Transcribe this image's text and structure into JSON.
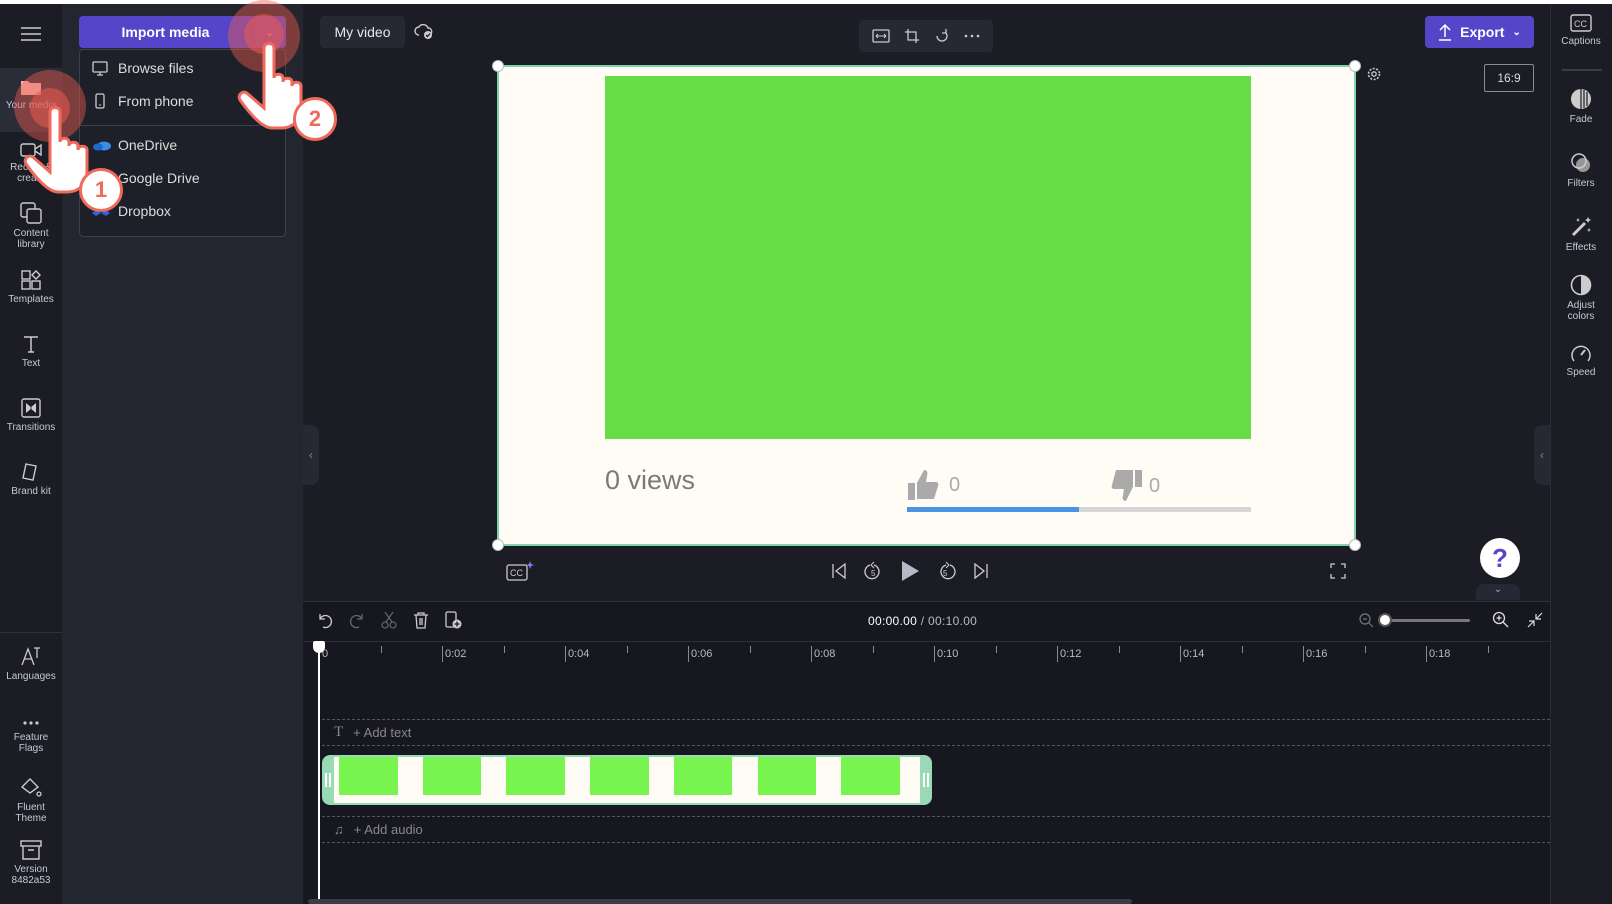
{
  "colors": {
    "accent": "#5546c9",
    "clip_border": "#7fd3ae",
    "green_screen": "#66dd44",
    "annotation": "#ef6a5a"
  },
  "leftnav": {
    "menu_icon": "hamburger-icon",
    "items": [
      {
        "label": "Your media",
        "icon": "folder-icon",
        "active": true
      },
      {
        "label": "Record & create",
        "icon": "camera-icon"
      },
      {
        "label": "Content library",
        "icon": "library-icon"
      },
      {
        "label": "Templates",
        "icon": "templates-icon"
      },
      {
        "label": "Text",
        "icon": "text-icon"
      },
      {
        "label": "Transitions",
        "icon": "transitions-icon"
      },
      {
        "label": "Brand kit",
        "icon": "brand-icon"
      }
    ],
    "bottom_items": [
      {
        "label": "Languages",
        "icon": "languages-icon"
      },
      {
        "label": "Feature Flags",
        "icon": "more-icon"
      },
      {
        "label": "Fluent Theme",
        "icon": "paint-bucket-icon"
      },
      {
        "label": "Version 8482a53",
        "icon": "archive-icon"
      }
    ]
  },
  "media": {
    "import_label": "Import media",
    "dropdown": [
      {
        "label": "Browse files",
        "icon": "monitor-icon"
      },
      {
        "label": "From phone",
        "icon": "phone-icon"
      },
      {
        "label": "OneDrive",
        "icon": "onedrive-icon"
      },
      {
        "label": "Google Drive",
        "icon": "google-drive-icon"
      },
      {
        "label": "Dropbox",
        "icon": "dropbox-icon"
      }
    ]
  },
  "header": {
    "project_title": "My video",
    "export_label": "Export",
    "aspect_ratio": "16:9"
  },
  "preview": {
    "views": "0 views",
    "likes": "0",
    "dislikes": "0",
    "like_ratio": 0.5
  },
  "timeline": {
    "current_time": "00:00.00",
    "total_time": "/ 00:10.00",
    "ruler": [
      "0",
      "0:02",
      "0:04",
      "0:06",
      "0:08",
      "0:10",
      "0:12",
      "0:14",
      "0:16",
      "0:18"
    ],
    "add_text": "+ Add text",
    "add_audio": "+ Add audio",
    "zoom_level": 0
  },
  "rightpanel": {
    "items": [
      {
        "label": "Captions",
        "icon": "captions-icon"
      },
      {
        "label": "Fade",
        "icon": "fade-icon"
      },
      {
        "label": "Filters",
        "icon": "filters-icon"
      },
      {
        "label": "Effects",
        "icon": "effects-icon"
      },
      {
        "label": "Adjust colors",
        "icon": "adjust-colors-icon"
      },
      {
        "label": "Speed",
        "icon": "speed-icon"
      }
    ]
  },
  "annotations": {
    "step1": "1",
    "step2": "2"
  }
}
